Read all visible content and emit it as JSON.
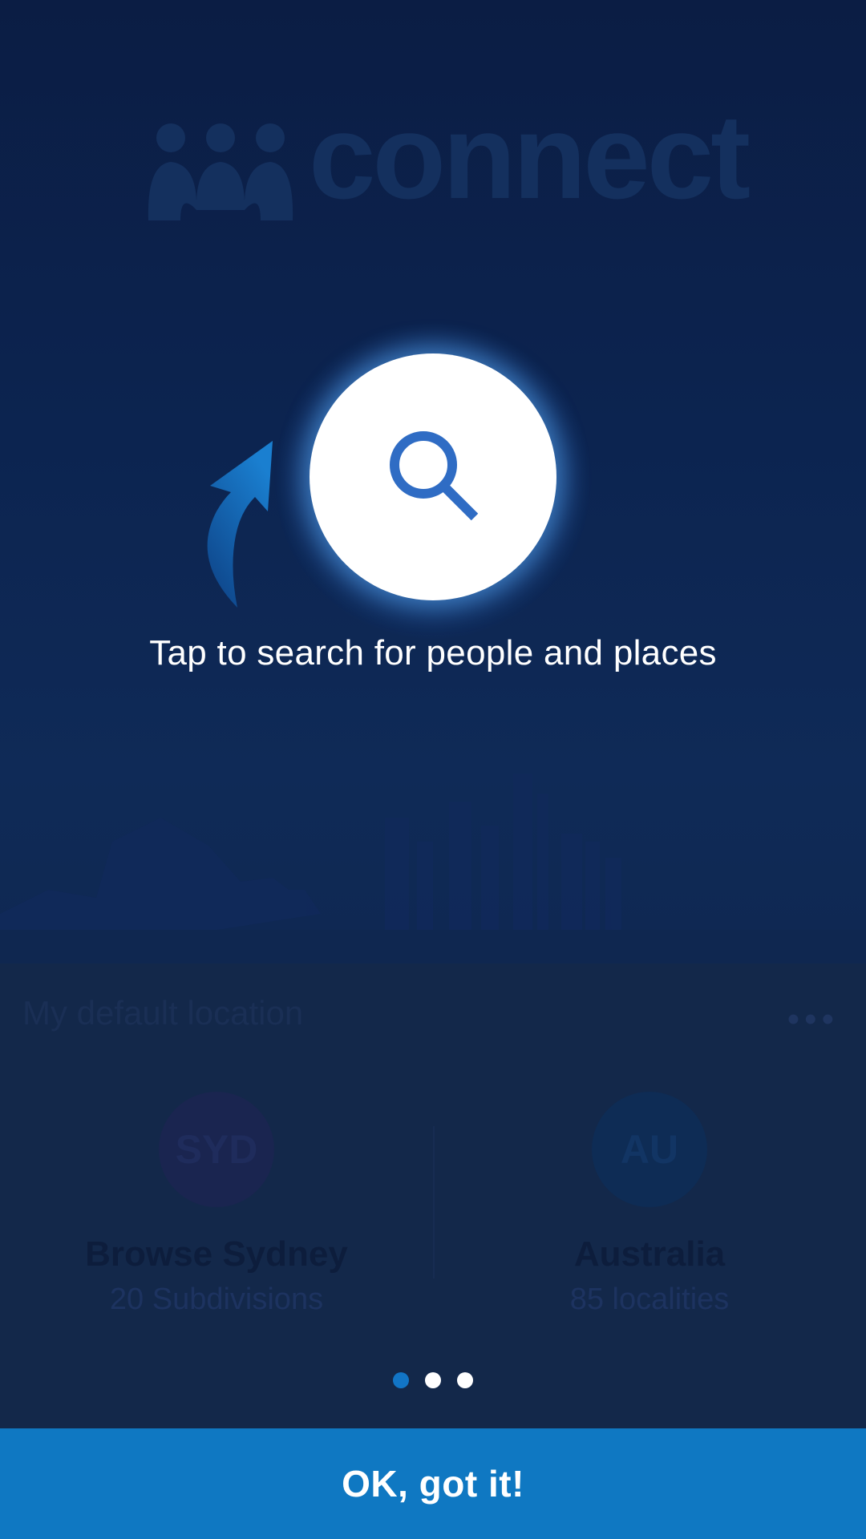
{
  "background": {
    "logo_text": "connect",
    "section_title": "My default location",
    "locations": [
      {
        "code": "SYD",
        "name": "Browse Sydney",
        "subtitle": "20 Subdivisions"
      },
      {
        "code": "AU",
        "name": "Australia",
        "subtitle": "85 localities"
      }
    ]
  },
  "coach_mark": {
    "icon": "search-icon",
    "hint": "Tap to search for people and places",
    "pager": {
      "total": 3,
      "active_index": 0
    },
    "button_label": "OK, got it!"
  },
  "colors": {
    "overlay_bg": "#0b1d44",
    "accent": "#0f78c2",
    "active_dot": "#1275c6",
    "search_icon": "#2f6cc4"
  }
}
